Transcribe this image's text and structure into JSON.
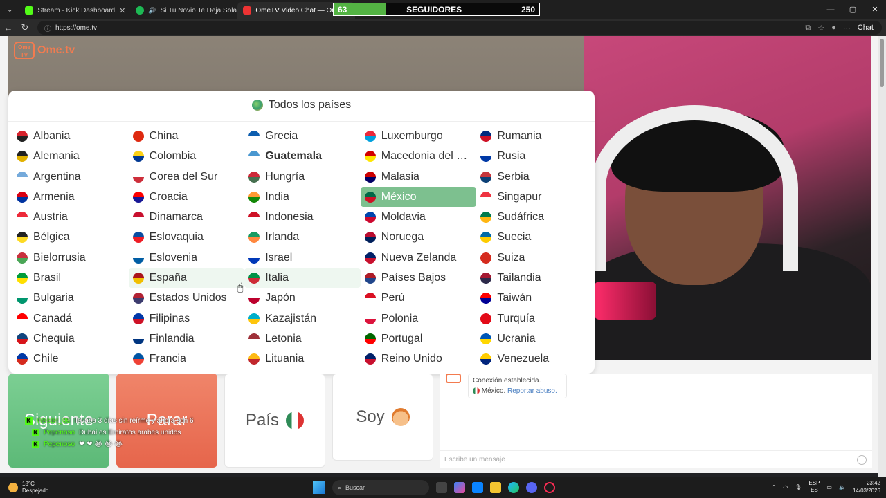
{
  "browser": {
    "tabs": [
      {
        "label": "Stream - Kick Dashboard",
        "color": "#53fc18"
      },
      {
        "label": "Si Tu Novio Te Deja Sola • J B…",
        "color": "#1db954"
      },
      {
        "label": "OmeTV Video Chat — Ome…",
        "color": "#e33"
      }
    ],
    "url": "https://ome.tv",
    "chat_label": "Chat",
    "window_controls": {
      "minimize": "—",
      "maximize": "▢",
      "close": "✕"
    }
  },
  "followers_bar": {
    "current": "63",
    "label": "SEGUIDORES",
    "goal": "250",
    "progress": 0.252
  },
  "site": {
    "logo_text": "Ome.tv",
    "logo_box": "Ome TV"
  },
  "country_modal": {
    "title": "Todos los países",
    "countries": [
      {
        "name": "Albania",
        "c1": "#d5222c",
        "c2": "#222"
      },
      {
        "name": "Alemania",
        "c1": "#222",
        "c2": "#e2b100"
      },
      {
        "name": "Argentina",
        "c1": "#75aadb",
        "c2": "#fff"
      },
      {
        "name": "Armenia",
        "c1": "#d90012",
        "c2": "#0033a0"
      },
      {
        "name": "Austria",
        "c1": "#ed2939",
        "c2": "#fff"
      },
      {
        "name": "Bélgica",
        "c1": "#222",
        "c2": "#fdda24"
      },
      {
        "name": "Bielorrusia",
        "c1": "#c8313e",
        "c2": "#4aa657"
      },
      {
        "name": "Brasil",
        "c1": "#009c3b",
        "c2": "#ffdf00"
      },
      {
        "name": "Bulgaria",
        "c1": "#fff",
        "c2": "#00966e"
      },
      {
        "name": "Canadá",
        "c1": "#ff0000",
        "c2": "#fff"
      },
      {
        "name": "Chequia",
        "c1": "#11457e",
        "c2": "#d7141a"
      },
      {
        "name": "Chile",
        "c1": "#0039a6",
        "c2": "#d52b1e"
      },
      {
        "name": "China",
        "c1": "#de2910",
        "c2": "#de2910"
      },
      {
        "name": "Colombia",
        "c1": "#fcd116",
        "c2": "#003893"
      },
      {
        "name": "Corea del Sur",
        "c1": "#fff",
        "c2": "#cd2e3a"
      },
      {
        "name": "Croacia",
        "c1": "#ff0000",
        "c2": "#171796"
      },
      {
        "name": "Dinamarca",
        "c1": "#c8102e",
        "c2": "#fff"
      },
      {
        "name": "Eslovaquia",
        "c1": "#0b4ea2",
        "c2": "#ee1c25"
      },
      {
        "name": "Eslovenia",
        "c1": "#fff",
        "c2": "#005da4"
      },
      {
        "name": "España",
        "c1": "#aa151b",
        "c2": "#f1bf00"
      },
      {
        "name": "Estados Unidos",
        "c1": "#b22234",
        "c2": "#3c3b6e"
      },
      {
        "name": "Filipinas",
        "c1": "#0038a8",
        "c2": "#ce1126"
      },
      {
        "name": "Finlandia",
        "c1": "#fff",
        "c2": "#003580"
      },
      {
        "name": "Francia",
        "c1": "#0055a4",
        "c2": "#ef4135"
      },
      {
        "name": "Grecia",
        "c1": "#0d5eaf",
        "c2": "#fff"
      },
      {
        "name": "Guatemala",
        "c1": "#4997d0",
        "c2": "#fff",
        "bold": true
      },
      {
        "name": "Hungría",
        "c1": "#ce2939",
        "c2": "#477050"
      },
      {
        "name": "India",
        "c1": "#ff9933",
        "c2": "#138808"
      },
      {
        "name": "Indonesia",
        "c1": "#ce1126",
        "c2": "#fff"
      },
      {
        "name": "Irlanda",
        "c1": "#169b62",
        "c2": "#ff883e"
      },
      {
        "name": "Israel",
        "c1": "#fff",
        "c2": "#0038b8"
      },
      {
        "name": "Italia",
        "c1": "#009246",
        "c2": "#ce2b37"
      },
      {
        "name": "Japón",
        "c1": "#fff",
        "c2": "#bc002d"
      },
      {
        "name": "Kazajistán",
        "c1": "#00afca",
        "c2": "#fec50c"
      },
      {
        "name": "Letonia",
        "c1": "#9e3039",
        "c2": "#fff"
      },
      {
        "name": "Lituania",
        "c1": "#fdb913",
        "c2": "#c1272d"
      },
      {
        "name": "Luxemburgo",
        "c1": "#ed2939",
        "c2": "#00a1de"
      },
      {
        "name": "Macedonia del …",
        "c1": "#d20000",
        "c2": "#ffe600"
      },
      {
        "name": "Malasia",
        "c1": "#cc0001",
        "c2": "#010066"
      },
      {
        "name": "México",
        "c1": "#006847",
        "c2": "#ce1126",
        "selected": true
      },
      {
        "name": "Moldavia",
        "c1": "#0046ae",
        "c2": "#cc092f"
      },
      {
        "name": "Noruega",
        "c1": "#ba0c2f",
        "c2": "#00205b"
      },
      {
        "name": "Nueva Zelanda",
        "c1": "#012169",
        "c2": "#c8102e"
      },
      {
        "name": "Países Bajos",
        "c1": "#ae1c28",
        "c2": "#21468b"
      },
      {
        "name": "Perú",
        "c1": "#d91023",
        "c2": "#fff"
      },
      {
        "name": "Polonia",
        "c1": "#fff",
        "c2": "#dc143c"
      },
      {
        "name": "Portugal",
        "c1": "#006600",
        "c2": "#ff0000"
      },
      {
        "name": "Reino Unido",
        "c1": "#012169",
        "c2": "#c8102e"
      },
      {
        "name": "Rumania",
        "c1": "#002b7f",
        "c2": "#ce1126"
      },
      {
        "name": "Rusia",
        "c1": "#fff",
        "c2": "#0039a6"
      },
      {
        "name": "Serbia",
        "c1": "#c6363c",
        "c2": "#0c4076"
      },
      {
        "name": "Singapur",
        "c1": "#ef3340",
        "c2": "#fff"
      },
      {
        "name": "Sudáfrica",
        "c1": "#007a4d",
        "c2": "#ffb612"
      },
      {
        "name": "Suecia",
        "c1": "#006aa7",
        "c2": "#fecc00"
      },
      {
        "name": "Suiza",
        "c1": "#d52b1e",
        "c2": "#d52b1e"
      },
      {
        "name": "Tailandia",
        "c1": "#a51931",
        "c2": "#2d2a4a"
      },
      {
        "name": "Taiwán",
        "c1": "#fe0000",
        "c2": "#000095"
      },
      {
        "name": "Turquía",
        "c1": "#e30a17",
        "c2": "#e30a17"
      },
      {
        "name": "Ucrania",
        "c1": "#0057b7",
        "c2": "#ffd700"
      },
      {
        "name": "Venezuela",
        "c1": "#ffcc00",
        "c2": "#00247d"
      }
    ]
  },
  "controls": {
    "next_label": "Siguiente",
    "stop_label": "Parar",
    "country_label": "País",
    "me_label": "Soy"
  },
  "stream_chat": [
    {
      "user": "Wester_06",
      "text": "llevaba 3 días sin reírme y ahora son 6"
    },
    {
      "user": "Pepenoso",
      "text": "Dubai es Emiratos arabes unidos"
    },
    {
      "user": "Pepenoso",
      "text": "❤ ❤ 😂 😂 😂"
    }
  ],
  "chat": {
    "system_line1": "Conexión establecida.",
    "system_country": "México.",
    "report_link": "Reportar abuso.",
    "input_placeholder": "Escribe un mensaje"
  },
  "taskbar": {
    "temperature": "18°C",
    "weather": "Despejado",
    "search_label": "Buscar",
    "lang1": "ESP",
    "lang2": "ES",
    "time": "23:42",
    "date": "14/03/2026"
  }
}
